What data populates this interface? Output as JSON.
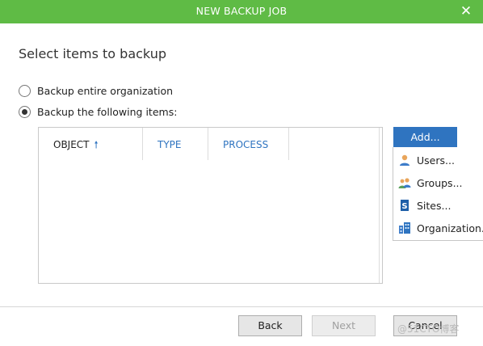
{
  "window": {
    "title": "NEW BACKUP JOB"
  },
  "heading": "Select items to backup",
  "options": [
    {
      "label": "Backup entire organization",
      "checked": false
    },
    {
      "label": "Backup the following items:",
      "checked": true
    }
  ],
  "grid": {
    "columns": [
      {
        "label": "OBJECT",
        "sorted": "ascending"
      },
      {
        "label": "TYPE"
      },
      {
        "label": "PROCESS"
      }
    ],
    "rows": []
  },
  "add_button": "Add...",
  "add_menu": [
    {
      "label": "Users...",
      "icon": "user-icon"
    },
    {
      "label": "Groups...",
      "icon": "group-icon"
    },
    {
      "label": "Sites...",
      "icon": "sharepoint-icon"
    },
    {
      "label": "Organization...",
      "icon": "organization-icon"
    }
  ],
  "footer": {
    "back": "Back",
    "next": "Next",
    "cancel": "Cancel"
  },
  "watermark": "@51CTO博客",
  "colors": {
    "titlebar": "#5fbb45",
    "accent": "#2f74c0"
  }
}
